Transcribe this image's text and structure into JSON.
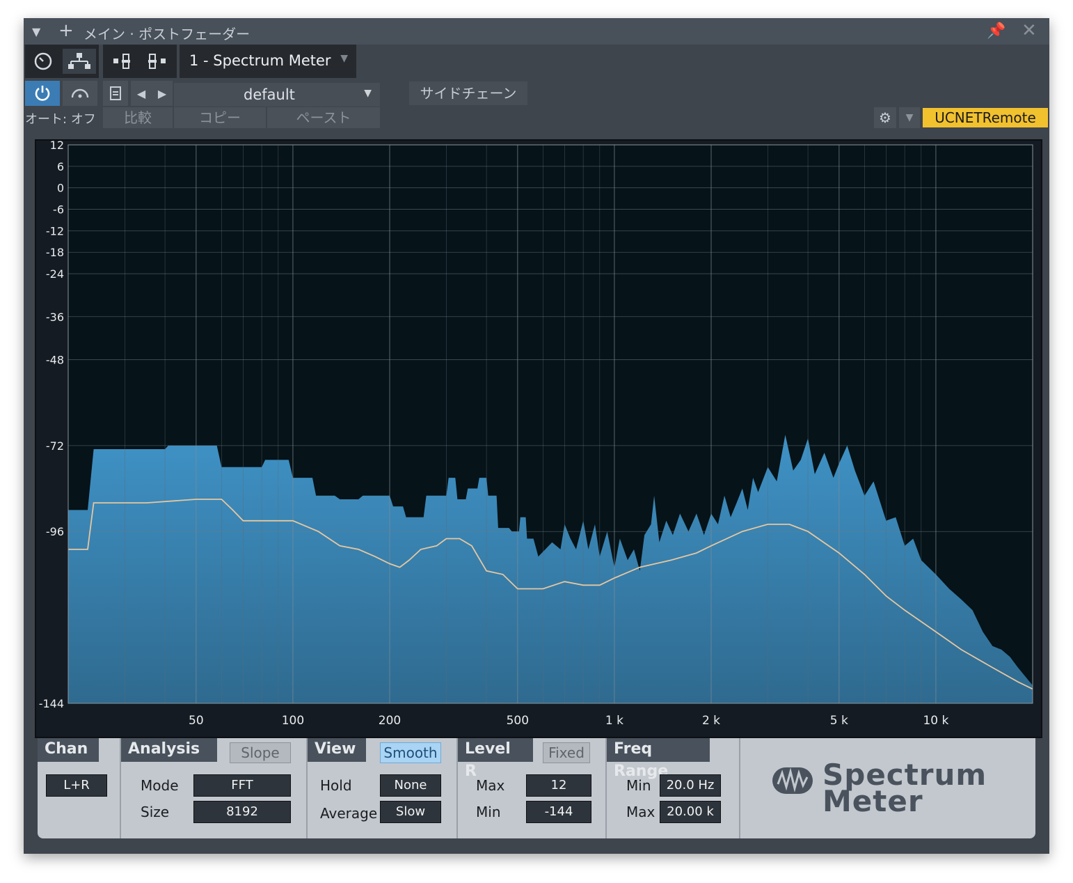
{
  "window": {
    "title": "メイン · ポストフェーダー"
  },
  "toolbar": {
    "plugin_selector": "1 - Spectrum Meter",
    "preset": "default",
    "sidechain": "サイドチェーン",
    "auto_label": "オート: オフ",
    "compare": "比較",
    "copy": "コピー",
    "paste": "ペースト",
    "remote": "UCNETRemote"
  },
  "colors": {
    "accent": "#2f6ea6",
    "remote_badge": "#f2c12e",
    "spectrum_fill": "#3a8cc0",
    "average_line": "#e6c7a0",
    "graph_bg": "#061318"
  },
  "chart_data": {
    "type": "area",
    "title": "",
    "xscale": "log",
    "xlim": [
      20,
      20000
    ],
    "ylim": [
      -144,
      12
    ],
    "x_ticks": [
      {
        "v": 50,
        "label": "50"
      },
      {
        "v": 100,
        "label": "100"
      },
      {
        "v": 200,
        "label": "200"
      },
      {
        "v": 500,
        "label": "500"
      },
      {
        "v": 1000,
        "label": "1 k"
      },
      {
        "v": 2000,
        "label": "2 k"
      },
      {
        "v": 5000,
        "label": "5 k"
      },
      {
        "v": 10000,
        "label": "10 k"
      }
    ],
    "y_ticks": [
      {
        "v": 12,
        "label": "12"
      },
      {
        "v": 6,
        "label": "6"
      },
      {
        "v": 0,
        "label": "0"
      },
      {
        "v": -6,
        "label": "-6"
      },
      {
        "v": -12,
        "label": "-12"
      },
      {
        "v": -18,
        "label": "-18"
      },
      {
        "v": -24,
        "label": "-24"
      },
      {
        "v": -36,
        "label": "-36"
      },
      {
        "v": -48,
        "label": "-48"
      },
      {
        "v": -72,
        "label": "-72"
      },
      {
        "v": -96,
        "label": "-96"
      },
      {
        "v": -144,
        "label": "-144"
      }
    ],
    "series": [
      {
        "role": "spectrum",
        "points": [
          [
            20,
            -90
          ],
          [
            23,
            -90
          ],
          [
            24,
            -73
          ],
          [
            40,
            -73
          ],
          [
            41,
            -72
          ],
          [
            58,
            -72
          ],
          [
            60,
            -78
          ],
          [
            80,
            -78
          ],
          [
            82,
            -76
          ],
          [
            97,
            -76
          ],
          [
            100,
            -81
          ],
          [
            115,
            -81
          ],
          [
            118,
            -86
          ],
          [
            135,
            -86
          ],
          [
            140,
            -87
          ],
          [
            160,
            -87
          ],
          [
            165,
            -86
          ],
          [
            200,
            -86
          ],
          [
            205,
            -89
          ],
          [
            220,
            -89
          ],
          [
            225,
            -92
          ],
          [
            255,
            -92
          ],
          [
            260,
            -86
          ],
          [
            300,
            -86
          ],
          [
            305,
            -81
          ],
          [
            320,
            -81
          ],
          [
            325,
            -87
          ],
          [
            345,
            -87
          ],
          [
            350,
            -84
          ],
          [
            375,
            -84
          ],
          [
            380,
            -81
          ],
          [
            400,
            -81
          ],
          [
            405,
            -86
          ],
          [
            430,
            -86
          ],
          [
            435,
            -95
          ],
          [
            470,
            -95
          ],
          [
            480,
            -96
          ],
          [
            505,
            -96
          ],
          [
            510,
            -92
          ],
          [
            530,
            -92
          ],
          [
            535,
            -98
          ],
          [
            560,
            -98
          ],
          [
            580,
            -103
          ],
          [
            610,
            -101
          ],
          [
            640,
            -99
          ],
          [
            680,
            -101
          ],
          [
            700,
            -94
          ],
          [
            730,
            -98
          ],
          [
            760,
            -101
          ],
          [
            800,
            -93
          ],
          [
            830,
            -101
          ],
          [
            870,
            -94
          ],
          [
            900,
            -103
          ],
          [
            950,
            -96
          ],
          [
            1000,
            -106
          ],
          [
            1040,
            -98
          ],
          [
            1100,
            -104
          ],
          [
            1150,
            -101
          ],
          [
            1200,
            -107
          ],
          [
            1240,
            -97
          ],
          [
            1300,
            -94
          ],
          [
            1330,
            -86
          ],
          [
            1380,
            -99
          ],
          [
            1450,
            -93
          ],
          [
            1520,
            -97
          ],
          [
            1600,
            -91
          ],
          [
            1700,
            -96
          ],
          [
            1800,
            -91
          ],
          [
            1900,
            -97
          ],
          [
            2000,
            -91
          ],
          [
            2100,
            -94
          ],
          [
            2200,
            -86
          ],
          [
            2300,
            -92
          ],
          [
            2400,
            -88
          ],
          [
            2500,
            -84
          ],
          [
            2600,
            -90
          ],
          [
            2700,
            -81
          ],
          [
            2800,
            -85
          ],
          [
            3000,
            -78
          ],
          [
            3200,
            -82
          ],
          [
            3400,
            -69
          ],
          [
            3600,
            -79
          ],
          [
            3800,
            -76
          ],
          [
            4000,
            -70
          ],
          [
            4200,
            -80
          ],
          [
            4500,
            -74
          ],
          [
            4800,
            -81
          ],
          [
            5000,
            -77
          ],
          [
            5300,
            -72
          ],
          [
            5600,
            -79
          ],
          [
            6000,
            -86
          ],
          [
            6400,
            -82
          ],
          [
            7000,
            -93
          ],
          [
            7500,
            -92
          ],
          [
            8000,
            -100
          ],
          [
            8500,
            -98
          ],
          [
            9000,
            -104
          ],
          [
            10000,
            -108
          ],
          [
            11000,
            -112
          ],
          [
            12000,
            -115
          ],
          [
            13000,
            -118
          ],
          [
            14000,
            -124
          ],
          [
            15000,
            -128
          ],
          [
            16000,
            -129
          ],
          [
            17000,
            -131
          ],
          [
            18000,
            -134
          ],
          [
            20000,
            -139
          ]
        ]
      },
      {
        "role": "average",
        "points": [
          [
            20,
            -101
          ],
          [
            23,
            -101
          ],
          [
            24,
            -88
          ],
          [
            35,
            -88
          ],
          [
            50,
            -87
          ],
          [
            60,
            -87
          ],
          [
            65,
            -90
          ],
          [
            70,
            -93
          ],
          [
            80,
            -93
          ],
          [
            100,
            -93
          ],
          [
            120,
            -96
          ],
          [
            140,
            -100
          ],
          [
            160,
            -101
          ],
          [
            180,
            -103
          ],
          [
            200,
            -105
          ],
          [
            215,
            -106
          ],
          [
            230,
            -104
          ],
          [
            250,
            -101
          ],
          [
            280,
            -100
          ],
          [
            300,
            -98
          ],
          [
            330,
            -98
          ],
          [
            360,
            -100
          ],
          [
            400,
            -107
          ],
          [
            450,
            -108
          ],
          [
            500,
            -112
          ],
          [
            550,
            -112
          ],
          [
            600,
            -112
          ],
          [
            700,
            -110
          ],
          [
            800,
            -111
          ],
          [
            900,
            -111
          ],
          [
            1000,
            -109
          ],
          [
            1200,
            -106
          ],
          [
            1500,
            -104
          ],
          [
            1800,
            -102
          ],
          [
            2000,
            -100
          ],
          [
            2500,
            -96
          ],
          [
            3000,
            -94
          ],
          [
            3500,
            -94
          ],
          [
            4000,
            -96
          ],
          [
            5000,
            -102
          ],
          [
            6000,
            -108
          ],
          [
            7000,
            -114
          ],
          [
            8000,
            -118
          ],
          [
            10000,
            -124
          ],
          [
            12000,
            -129
          ],
          [
            15000,
            -134
          ],
          [
            18000,
            -138
          ],
          [
            20000,
            -140
          ]
        ]
      }
    ]
  },
  "controls": {
    "chan": {
      "header": "Chan",
      "value": "L+R"
    },
    "analysis": {
      "header": "Analysis",
      "slope": "Slope",
      "mode_label": "Mode",
      "mode": "FFT",
      "size_label": "Size",
      "size": "8192"
    },
    "view": {
      "header": "View",
      "smooth": "Smooth",
      "hold_label": "Hold",
      "hold": "None",
      "avg_label": "Average",
      "avg": "Slow"
    },
    "level": {
      "header": "Level R",
      "fixed": "Fixed",
      "max_label": "Max",
      "max": "12",
      "min_label": "Min",
      "min": "-144"
    },
    "freq": {
      "header": "Freq Range",
      "min_label": "Min",
      "min": "20.0 Hz",
      "max_label": "Max",
      "max": "20.00 k"
    },
    "logo": {
      "line1": "Spectrum",
      "line2": "Meter"
    }
  }
}
